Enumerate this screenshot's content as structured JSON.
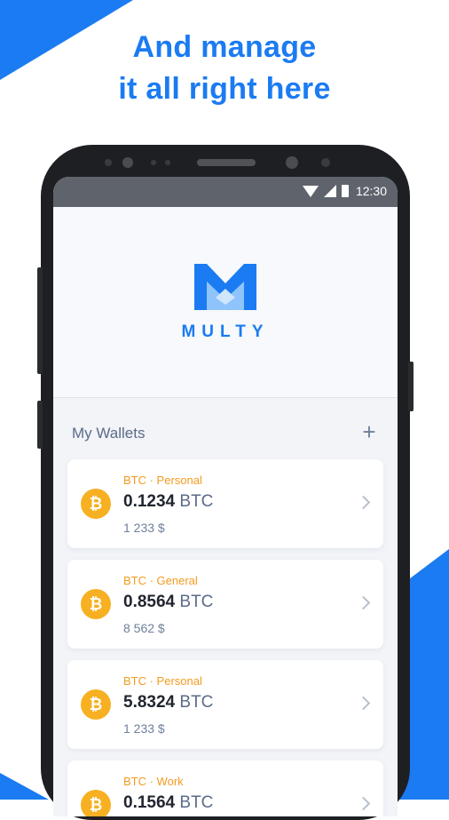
{
  "headline": {
    "line1": "And manage",
    "line2": "it all right here"
  },
  "status_bar": {
    "time": "12:30",
    "icons": [
      "wifi-icon",
      "signal-icon",
      "battery-icon"
    ]
  },
  "brand": {
    "logo_text": "MULTY",
    "accent_color": "#1b7bf2"
  },
  "wallets": {
    "title": "My Wallets",
    "add_label": "+",
    "items": [
      {
        "label": "BTC · Personal",
        "amount": "0.1234",
        "unit": "BTC",
        "fiat": "1 233 $",
        "coin_icon": "₿"
      },
      {
        "label": "BTC · General",
        "amount": "0.8564",
        "unit": "BTC",
        "fiat": "8 562 $",
        "coin_icon": "₿"
      },
      {
        "label": "BTC · Personal",
        "amount": "5.8324",
        "unit": "BTC",
        "fiat": "1 233 $",
        "coin_icon": "₿"
      },
      {
        "label": "BTC · Work",
        "amount": "0.1564",
        "unit": "BTC",
        "fiat": "",
        "coin_icon": "₿"
      }
    ]
  },
  "colors": {
    "primary": "#1b7bf2",
    "coin": "#f7b021",
    "label_orange": "#f29b1f"
  }
}
